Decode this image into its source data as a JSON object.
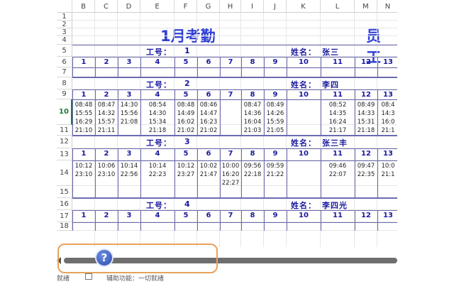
{
  "columns": [
    "B",
    "C",
    "D",
    "E",
    "F",
    "G",
    "H",
    "I",
    "J",
    "K",
    "L",
    "M",
    "N"
  ],
  "rows": [
    "1",
    "2",
    "3",
    "4",
    "5",
    "6",
    "7",
    "8",
    "9",
    "10",
    "11",
    "12",
    "13",
    "14",
    "15",
    "16",
    "17",
    "18"
  ],
  "selected_row": "10",
  "title": "1月考勤",
  "title_right": "员 工",
  "employees": [
    {
      "id_label": "工号：",
      "id": "1",
      "name_label": "姓名：",
      "name": "张三"
    },
    {
      "id_label": "工号：",
      "id": "2",
      "name_label": "姓名：",
      "name": "李四"
    },
    {
      "id_label": "工号：",
      "id": "3",
      "name_label": "姓名：",
      "name": "张三丰"
    },
    {
      "id_label": "工号：",
      "id": "4",
      "name_label": "姓名：",
      "name": "李四光"
    }
  ],
  "days": [
    "1",
    "2",
    "3",
    "4",
    "5",
    "6",
    "7",
    "8",
    "9",
    "10",
    "11",
    "12",
    "13"
  ],
  "times_emp2": [
    "08:48\n15:55\n16:29\n21:10",
    "08:47\n14:32\n15:57\n21:11",
    "14:30\n15:56\n21:08",
    "08:54\n14:30\n15:34\n21:18",
    "08:48\n14:49\n16:02\n21:02",
    "08:46\n14:47\n16:23\n21:02",
    "",
    "08:47\n14:36\n16:04\n21:03",
    "08:49\n14:26\n15:59\n21:05",
    "",
    "08:52\n14:35\n16:24\n21:17",
    "08:49\n14:33\n15:31\n21:18",
    "08:4\n14:3\n16:0\n21:1"
  ],
  "times_emp3": [
    "10:12\n23:10",
    "10:06\n23:10",
    "10:14\n22:56",
    "10:14\n22:23",
    "10:12\n23:27",
    "10:02\n21:47",
    "10:00\n16:20\n22:27",
    "09:56\n22:18",
    "09:59\n21:22",
    "",
    "09:46\n22:07",
    "09:47\n22:35",
    "10:0\n21:1"
  ],
  "status": {
    "ready": "就绪",
    "accessibility": "辅助功能：一切就绪"
  },
  "help_label": "?"
}
